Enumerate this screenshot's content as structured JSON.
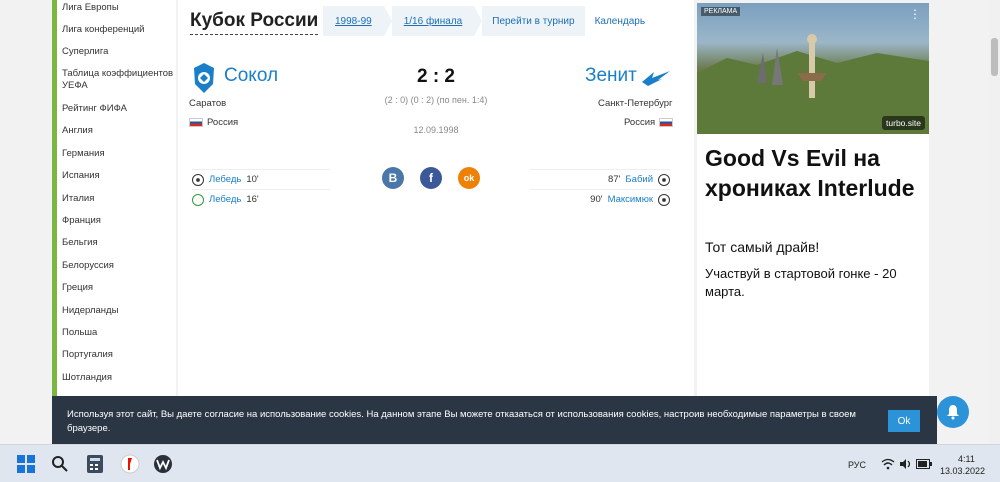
{
  "sidebar": {
    "items": [
      {
        "label": "Лига Европы"
      },
      {
        "label": "Лига конференций"
      },
      {
        "label": "Суперлига"
      },
      {
        "label": "Таблица коэффициентов УЕФА"
      },
      {
        "label": "Рейтинг ФИФА"
      },
      {
        "label": "Англия"
      },
      {
        "label": "Германия"
      },
      {
        "label": "Испания"
      },
      {
        "label": "Италия"
      },
      {
        "label": "Франция"
      },
      {
        "label": "Бельгия"
      },
      {
        "label": "Белоруссия"
      },
      {
        "label": "Греция"
      },
      {
        "label": "Нидерланды"
      },
      {
        "label": "Польша"
      },
      {
        "label": "Португалия"
      },
      {
        "label": "Шотландия"
      }
    ]
  },
  "header": {
    "title": "Кубок России",
    "season": "1998-99",
    "round": "1/16 финала",
    "tournament_link": "Перейти в турнир",
    "calendar_link": "Календарь"
  },
  "match": {
    "home": {
      "name": "Сокол",
      "city": "Саратов",
      "country": "Россия"
    },
    "away": {
      "name": "Зенит",
      "city": "Санкт-Петербург",
      "country": "Россия"
    },
    "score": "2 : 2",
    "score_detail": "(2 : 0) (0 : 2) (по пен. 1:4)",
    "date": "12.09.1998",
    "home_events": [
      {
        "player": "Лебедь",
        "minute": "10'"
      },
      {
        "player": "Лебедь",
        "minute": "16'"
      }
    ],
    "away_events": [
      {
        "minute": "87'",
        "player": "Бабий"
      },
      {
        "minute": "90'",
        "player": "Максимюк"
      }
    ]
  },
  "share": {
    "vk": "В",
    "fb": "f",
    "ok": "ok"
  },
  "ad": {
    "label": "РЕКЛАМА",
    "domain": "turbo.site",
    "headline": "Good Vs Evil на хрониках Interlude",
    "subtitle": "Тот самый драйв!",
    "text": "Участвуй в стартовой гонке - 20 марта."
  },
  "cookie": {
    "text": "Используя этот сайт, Вы даете согласие на использование cookies. На данном этапе Вы можете отказаться от использования cookies, настроив необходимые параметры в своем браузере.",
    "ok_label": "Ok"
  },
  "taskbar": {
    "lang": "РУС",
    "time": "4:11",
    "date": "13.03.2022"
  }
}
